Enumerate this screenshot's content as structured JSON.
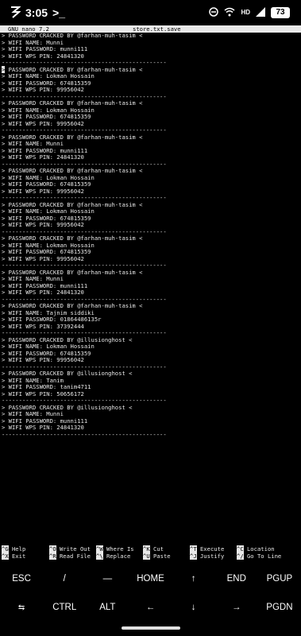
{
  "status_bar": {
    "time": "3:05",
    "terminal_prompt_glyph": ">_",
    "network_type": "HD",
    "signal_label": "LTE",
    "battery": "73"
  },
  "nano": {
    "version": "GNU nano 7.2",
    "filename": "store.txt.save"
  },
  "editor": {
    "lines": [
      "> PASSWORD CRACKED BY @farhan-muh-tasim <",
      "> WIFI NAME: Munni",
      "> WIFI PASSWORD: munni111",
      "> WIFI WPS PIN: 24841320",
      "------------------------------------------------",
      "> PASSWORD CRACKED BY @farhan-muh-tasim <",
      "> WIFI NAME: Lokman Hossain",
      "> WIFI PASSWORD: 674815359",
      "> WIFI WPS PIN: 99956042",
      "------------------------------------------------",
      "> PASSWORD CRACKED BY @farhan-muh-tasim <",
      "> WIFI NAME: Lokman Hossain",
      "> WIFI PASSWORD: 674815359",
      "> WIFI WPS PIN: 99956042",
      "------------------------------------------------",
      "> PASSWORD CRACKED BY @farhan-muh-tasim <",
      "> WIFI NAME: Munni",
      "> WIFI PASSWORD: munni111",
      "> WIFI WPS PIN: 24841320",
      "------------------------------------------------",
      "> PASSWORD CRACKED BY @farhan-muh-tasim <",
      "> WIFI NAME: Lokman Hossain",
      "> WIFI PASSWORD: 674815359",
      "> WIFI WPS PIN: 99956042",
      "------------------------------------------------",
      "> PASSWORD CRACKED BY @farhan-muh-tasim <",
      "> WIFI NAME: Lokman Hossain",
      "> WIFI PASSWORD: 674815359",
      "> WIFI WPS PIN: 99956042",
      "------------------------------------------------",
      "> PASSWORD CRACKED BY @farhan-muh-tasim <",
      "> WIFI NAME: Lokman Hossain",
      "> WIFI PASSWORD: 674815359",
      "> WIFI WPS PIN: 99956042",
      "------------------------------------------------",
      "> PASSWORD CRACKED BY @farhan-muh-tasim <",
      "> WIFI NAME: Munni",
      "> WIFI PASSWORD: munni111",
      "> WIFI WPS PIN: 24841320",
      "------------------------------------------------",
      "> PASSWORD CRACKED BY @farhan-muh-tasim <",
      "> WIFI NAME: Tajnim siddiki",
      "> WIFI PASSWORD: 01864486135r",
      "> WIFI WPS PIN: 37392444",
      "------------------------------------------------",
      "> PASSWORD CRACKED BY @illusionghost <",
      "> WIFI NAME: Lokman Hossain",
      "> WIFI PASSWORD: 674815359",
      "> WIFI WPS PIN: 99956042",
      "------------------------------------------------",
      "> PASSWORD CRACKED BY @illusionghost <",
      "> WIFI NAME: Tanim",
      "> WIFI PASSWORD: tanim4711",
      "> WIFI WPS PIN: 50656172",
      "------------------------------------------------",
      "> PASSWORD CRACKED BY @illusionghost <",
      "> WIFI NAME: Munni",
      "> WIFI PASSWORD: munni111",
      "> WIFI WPS PIN: 24841320",
      "------------------------------------------------"
    ],
    "cursor_line_index": 5
  },
  "shortcuts": [
    {
      "key1": "^G",
      "label1": "Help",
      "key2": "^X",
      "label2": "Exit"
    },
    {
      "key1": "^O",
      "label1": "Write Out",
      "key2": "^R",
      "label2": "Read File"
    },
    {
      "key1": "^W",
      "label1": "Where Is",
      "key2": "^\\",
      "label2": "Replace"
    },
    {
      "key1": "^K",
      "label1": "Cut",
      "key2": "^U",
      "label2": "Paste"
    },
    {
      "key1": "^T",
      "label1": "Execute",
      "key2": "^J",
      "label2": "Justify"
    },
    {
      "key1": "^C",
      "label1": "Location",
      "key2": "^/",
      "label2": "Go To Line"
    }
  ],
  "extra_keys": {
    "row1": [
      "ESC",
      "/",
      "—",
      "HOME",
      "↑",
      "END",
      "PGUP"
    ],
    "row2": [
      "⇆",
      "CTRL",
      "ALT",
      "←",
      "↓",
      "→",
      "PGDN"
    ]
  }
}
